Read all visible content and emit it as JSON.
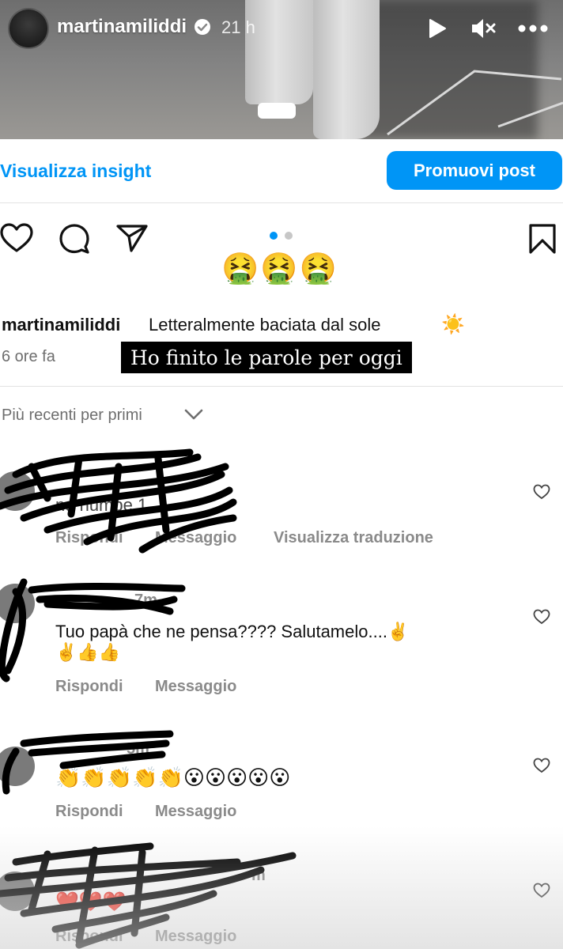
{
  "story": {
    "username": "martinamiliddi",
    "time": "21 h",
    "icons": [
      "play-icon",
      "mute-icon",
      "more-icon",
      "verified-icon"
    ]
  },
  "insights": {
    "link_label": "Visualizza insight",
    "promote_label": "Promuovi post"
  },
  "post": {
    "sticker_emoji": "🤮🤮🤮",
    "caption_user": "martinamiliddi",
    "caption_text": "Letteralmente baciata dal sole",
    "caption_emoji": "☀️",
    "time_ago": "6 ore fa",
    "overlay_text": "Ho finito le parole per oggi",
    "carousel": {
      "total": 2,
      "active": 1
    }
  },
  "sort": {
    "label": "Più recenti per primi"
  },
  "comments": [
    {
      "text_visible": "nd  numbe  1",
      "actions": [
        "Rispondi",
        "Messaggio",
        "Visualizza traduzione"
      ]
    },
    {
      "meta_visible": "7m",
      "text_line1": "Tuo papà che ne pensa???? Salutamelo....✌️",
      "text_line2": "✌️👍👍",
      "actions": [
        "Rispondi",
        "Messaggio"
      ]
    },
    {
      "meta_visible": "5m",
      "text_line1": "👏👏👏👏👏😮😮😮😮😮",
      "actions": [
        "Rispondi",
        "Messaggio"
      ]
    },
    {
      "meta_visible": "m",
      "text_line1": "❤️❤️❤️",
      "actions": [
        "Rispondi",
        "Messaggio"
      ]
    }
  ],
  "colors": {
    "accent": "#0095f6",
    "muted": "#8a8a8a",
    "overlay_bg": "#000000"
  }
}
